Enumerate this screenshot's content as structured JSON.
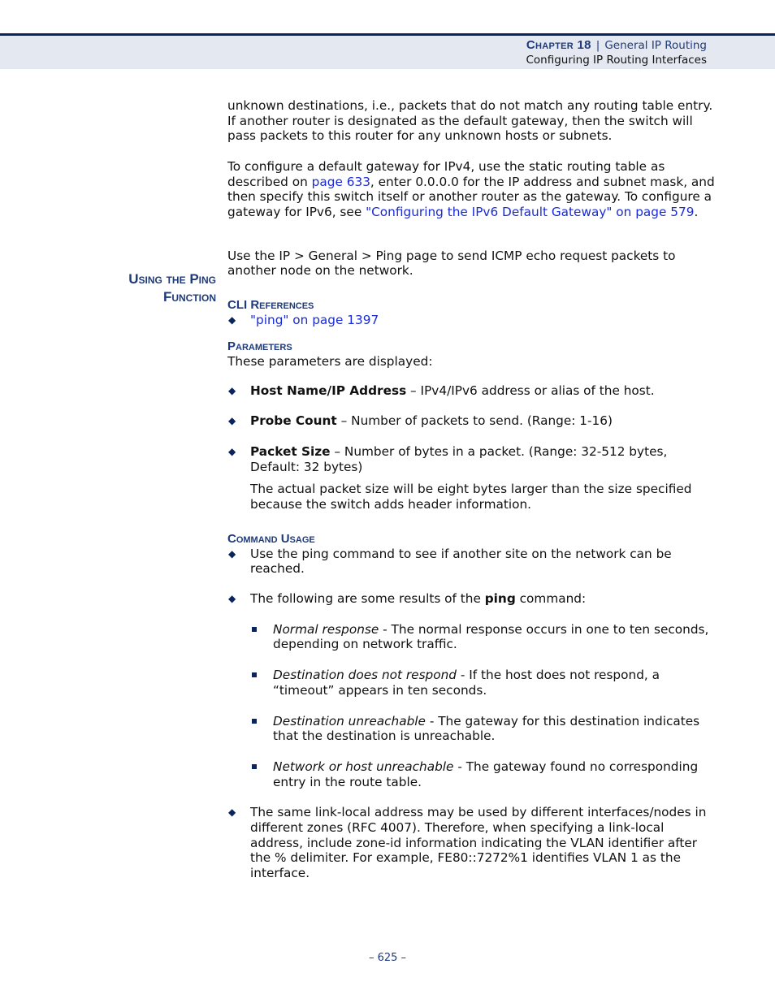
{
  "header": {
    "chapter_label": "Chapter 18",
    "separator": "|",
    "chapter_title": "General IP Routing",
    "section_title": "Configuring IP Routing Interfaces"
  },
  "intro": {
    "paragraph1": "unknown destinations, i.e., packets that do not match any routing table entry. If another router is designated as the default gateway, then the switch will pass packets to this router for any unknown hosts or subnets.",
    "paragraph2_a": "To configure a default gateway for IPv4, use the static routing table as described on ",
    "paragraph2_link1": "page 633",
    "paragraph2_b": ", enter 0.0.0.0 for the IP address and subnet mask, and then specify this switch itself or another router as the gateway. To configure a gateway for IPv6, see ",
    "paragraph2_link2": "\"Configuring the IPv6 Default Gateway\" on page 579",
    "paragraph2_c": "."
  },
  "section": {
    "title_line1": "Using the Ping",
    "title_line2": "Function",
    "description": "Use the IP > General > Ping page to send ICMP echo request packets to another node on the network."
  },
  "cli_references": {
    "heading": "CLI References",
    "links": [
      "\"ping\" on page 1397"
    ]
  },
  "parameters": {
    "heading": "Parameters",
    "intro": "These parameters are displayed:",
    "items": [
      {
        "term": "Host Name/IP Address",
        "desc": " – IPv4/IPv6 address or alias of the host."
      },
      {
        "term": "Probe Count",
        "desc": " – Number of packets to send. (Range: 1-16)"
      },
      {
        "term": "Packet Size",
        "desc": " – Number of bytes in a packet. (Range: 32-512 bytes, Default: 32 bytes)",
        "note": "The actual packet size will be eight bytes larger than the size specified because the switch adds header information."
      }
    ]
  },
  "command_usage": {
    "heading": "Command Usage",
    "item1": "Use the ping command to see if another site on the network can be reached.",
    "item2_a": "The following are some results of the ",
    "item2_bold": "ping",
    "item2_b": " command:",
    "results": [
      {
        "term": "Normal response",
        "desc": " - The normal response occurs in one to ten seconds, depending on network traffic."
      },
      {
        "term": "Destination does not respond",
        "desc": " - If the host does not respond, a “timeout” appears in ten seconds."
      },
      {
        "term": "Destination unreachable",
        "desc": " - The gateway for this destination indicates that the destination is unreachable."
      },
      {
        "term": "Network or host unreachable",
        "desc": " - The gateway found no corresponding entry in the route table."
      }
    ],
    "item3": "The same link-local address may be used by different interfaces/nodes in different zones (RFC 4007). Therefore, when specifying a link-local address, include zone-id information indicating the VLAN identifier after the % delimiter. For example, FE80::7272%1 identifies VLAN 1 as the interface."
  },
  "footer": {
    "page_number": "–  625  –"
  },
  "colors": {
    "heading": "#1f3a7a",
    "header_rule": "#0b2461",
    "header_band": "#e4e8f1",
    "link": "#1a2bd6"
  }
}
